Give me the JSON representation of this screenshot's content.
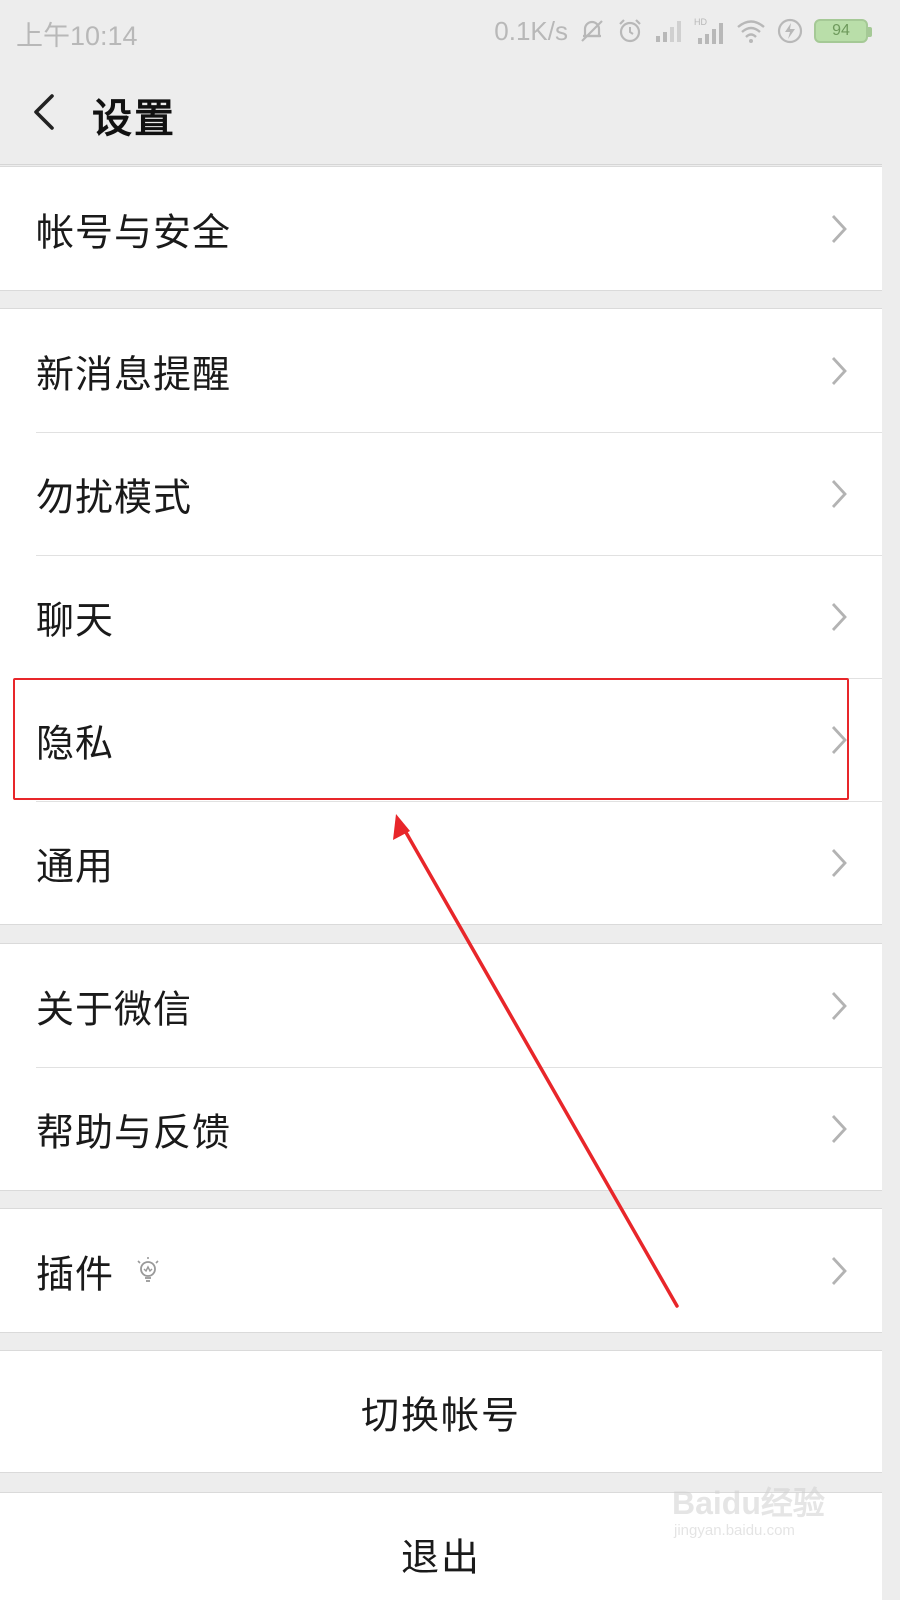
{
  "status_bar": {
    "time": "上午10:14",
    "speed": "0.1K/s",
    "battery": "94",
    "icons": [
      "mute-bell-icon",
      "alarm-icon",
      "signal-icon",
      "hd-signal-icon",
      "wifi-icon",
      "charging-icon",
      "battery-icon"
    ]
  },
  "header": {
    "back_icon": "chevron-left-icon",
    "title": "设置"
  },
  "groups": [
    {
      "items": [
        {
          "label": "帐号与安全"
        }
      ]
    },
    {
      "items": [
        {
          "label": "新消息提醒"
        },
        {
          "label": "勿扰模式"
        },
        {
          "label": "聊天"
        },
        {
          "label": "隐私"
        },
        {
          "label": "通用"
        }
      ]
    },
    {
      "items": [
        {
          "label": "关于微信"
        },
        {
          "label": "帮助与反馈"
        }
      ]
    },
    {
      "items": [
        {
          "label": "插件",
          "icon": "lightbulb-icon"
        }
      ]
    }
  ],
  "buttons": {
    "switch_account": "切换帐号",
    "logout": "退出"
  },
  "annotation": {
    "highlight_color": "#e8262a",
    "highlighted_item": "隐私"
  },
  "watermark": {
    "brand": "Baidu经验",
    "url": "jingyan.baidu.com"
  }
}
